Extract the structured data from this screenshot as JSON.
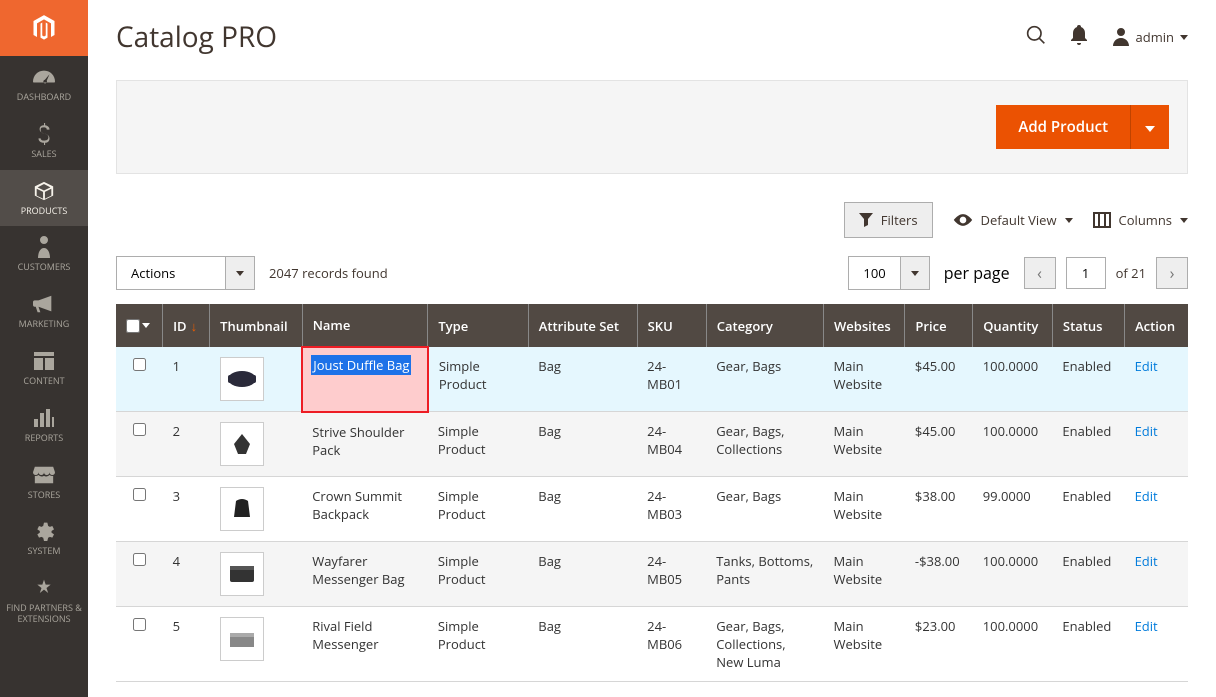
{
  "header": {
    "title": "Catalog PRO",
    "username": "admin"
  },
  "sidebar": {
    "items": [
      {
        "label": "DASHBOARD"
      },
      {
        "label": "SALES"
      },
      {
        "label": "PRODUCTS"
      },
      {
        "label": "CUSTOMERS"
      },
      {
        "label": "MARKETING"
      },
      {
        "label": "CONTENT"
      },
      {
        "label": "REPORTS"
      },
      {
        "label": "STORES"
      },
      {
        "label": "SYSTEM"
      },
      {
        "label": "FIND PARTNERS & EXTENSIONS"
      }
    ]
  },
  "buttons": {
    "add_product": "Add Product",
    "filters": "Filters",
    "default_view": "Default View",
    "columns": "Columns",
    "actions": "Actions"
  },
  "grid": {
    "records_found": "2047 records found",
    "page_size": "100",
    "per_page": "per page",
    "current_page": "1",
    "total_pages": "of 21"
  },
  "columns": [
    "ID",
    "Thumbnail",
    "Name",
    "Type",
    "Attribute Set",
    "SKU",
    "Category",
    "Websites",
    "Price",
    "Quantity",
    "Status",
    "Action"
  ],
  "rows": [
    {
      "id": "1",
      "name": "Joust Duffle Bag",
      "type": "Simple Product",
      "attr": "Bag",
      "sku": "24-MB01",
      "cat": "Gear, Bags",
      "web": "Main Website",
      "price": "$45.00",
      "qty": "100.0000",
      "status": "Enabled",
      "action": "Edit"
    },
    {
      "id": "2",
      "name": "Strive Shoulder Pack",
      "type": "Simple Product",
      "attr": "Bag",
      "sku": "24-MB04",
      "cat": "Gear, Bags, Collections",
      "web": "Main Website",
      "price": "$45.00",
      "qty": "100.0000",
      "status": "Enabled",
      "action": "Edit"
    },
    {
      "id": "3",
      "name": "Crown Summit Backpack",
      "type": "Simple Product",
      "attr": "Bag",
      "sku": "24-MB03",
      "cat": "Gear, Bags",
      "web": "Main Website",
      "price": "$38.00",
      "qty": "99.0000",
      "status": "Enabled",
      "action": "Edit"
    },
    {
      "id": "4",
      "name": "Wayfarer Messenger Bag",
      "type": "Simple Product",
      "attr": "Bag",
      "sku": "24-MB05",
      "cat": "Tanks, Bottoms, Pants",
      "web": "Main Website",
      "price": "-$38.00",
      "qty": "100.0000",
      "status": "Enabled",
      "action": "Edit"
    },
    {
      "id": "5",
      "name": "Rival Field Messenger",
      "type": "Simple Product",
      "attr": "Bag",
      "sku": "24-MB06",
      "cat": "Gear, Bags, Collections, New Luma",
      "web": "Main Website",
      "price": "$23.00",
      "qty": "100.0000",
      "status": "Enabled",
      "action": "Edit"
    }
  ]
}
